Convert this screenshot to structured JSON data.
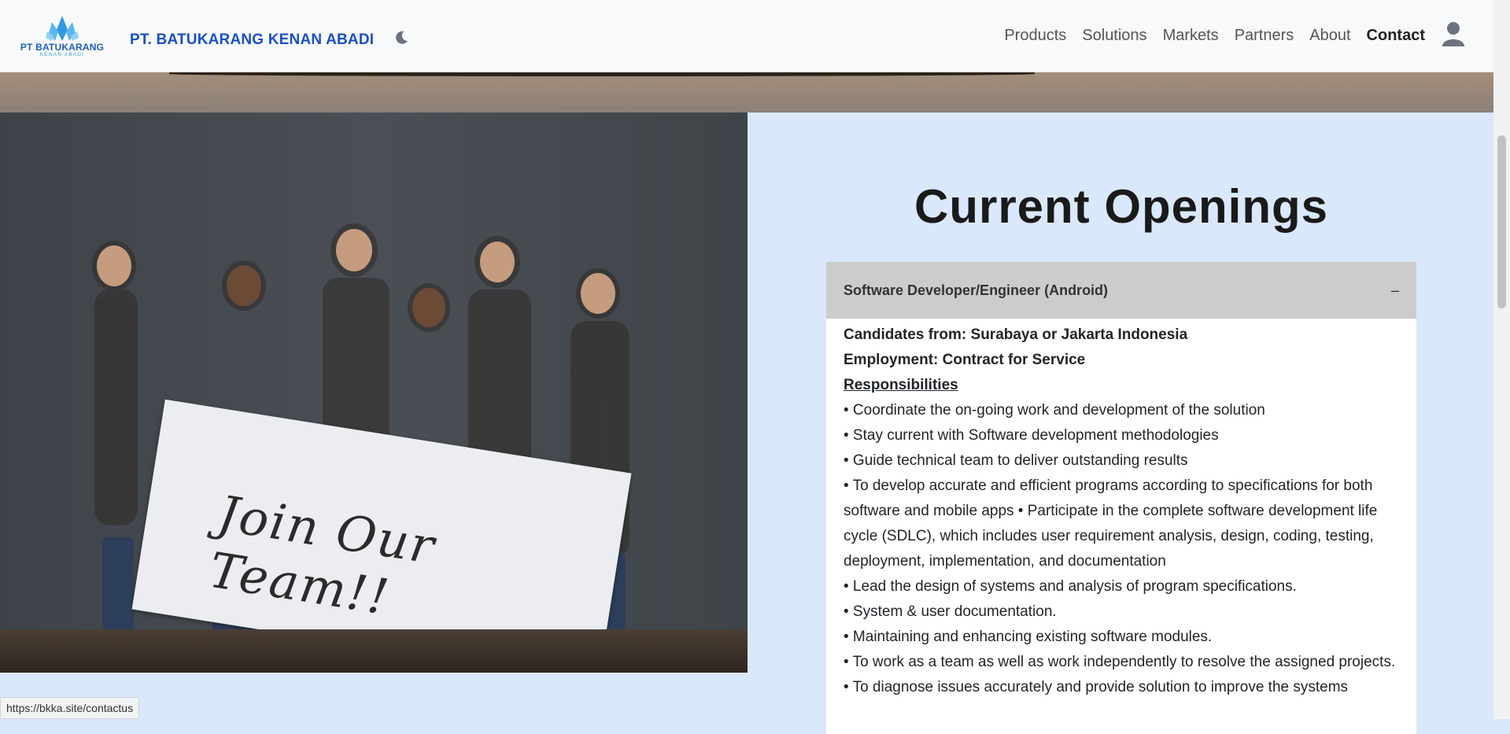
{
  "header": {
    "logo_text": "PT BATUKARANG",
    "logo_sub": "KENAN ABADI",
    "brand": "PT. BATUKARANG KENAN ABADI",
    "nav": [
      "Products",
      "Solutions",
      "Markets",
      "Partners",
      "About",
      "Contact"
    ],
    "active": "Contact"
  },
  "photo": {
    "sign_text": "Join Our Team!!"
  },
  "openings": {
    "title": "Current Openings",
    "job": {
      "title": "Software Developer/Engineer (Android)",
      "toggle": "–",
      "candidates": "Candidates from: Surabaya or Jakarta Indonesia",
      "employment": "Employment: Contract for Service",
      "responsibilities_label": "Responsibilities",
      "items": [
        "• Coordinate the on-going work and development of the solution",
        "• Stay current with Software development methodologies",
        "• Guide technical team to deliver outstanding results",
        "• To develop accurate and efficient programs according to specifications for both software and mobile apps • Participate in the complete software development life cycle (SDLC), which includes user requirement analysis, design, coding, testing, deployment, implementation, and documentation",
        "• Lead the design of systems and analysis of program specifications.",
        "• System & user documentation.",
        "• Maintaining and enhancing existing software modules.",
        "• To work as a team as well as work independently to resolve the assigned projects.",
        "• To diagnose issues accurately and provide solution to improve the systems"
      ]
    }
  },
  "status_url": "https://bkka.site/contactus",
  "colors": {
    "brand_blue": "#1b4fc4",
    "page_bg": "#dae8fc",
    "accordion_header": "#cccccc"
  }
}
